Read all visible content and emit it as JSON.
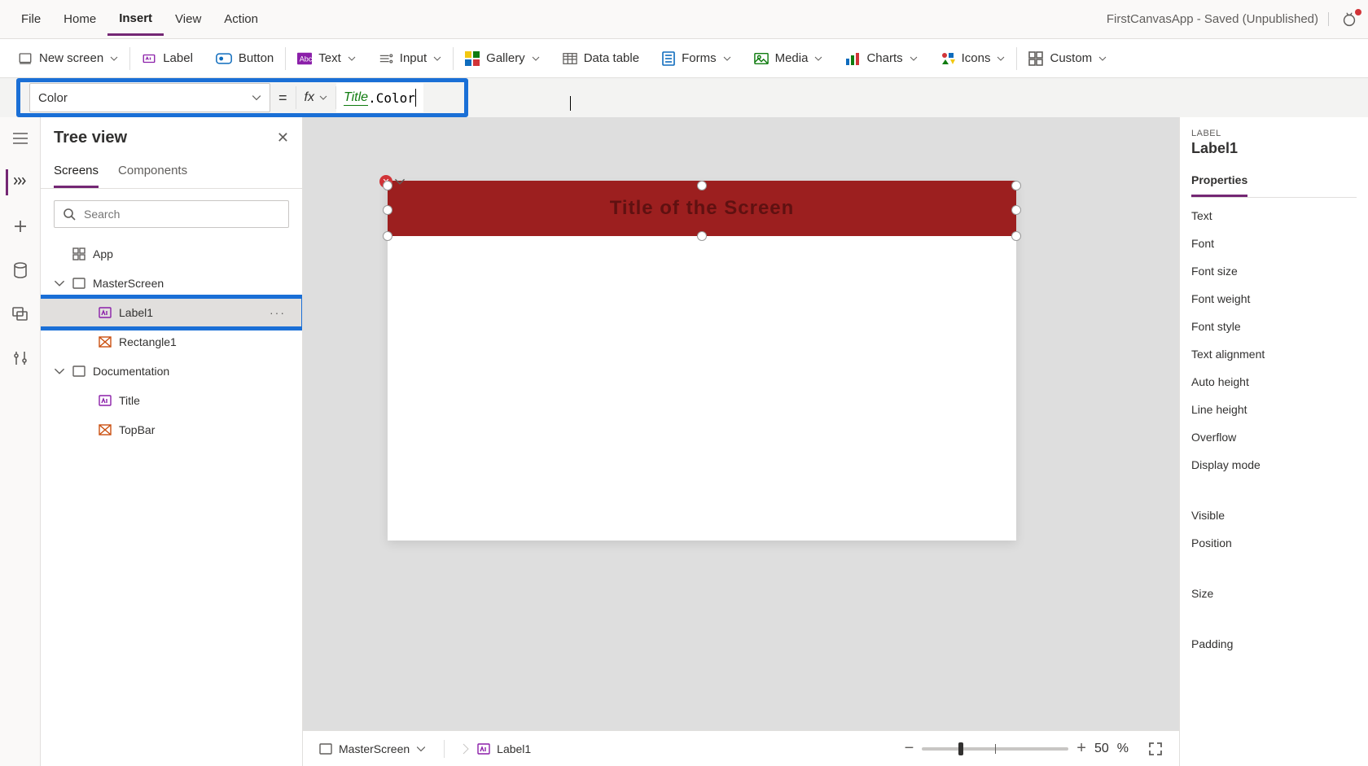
{
  "app": {
    "title": "FirstCanvasApp - Saved (Unpublished)"
  },
  "menu": {
    "file": "File",
    "home": "Home",
    "insert": "Insert",
    "view": "View",
    "action": "Action"
  },
  "ribbon": {
    "new_screen": "New screen",
    "label": "Label",
    "button": "Button",
    "text": "Text",
    "input": "Input",
    "gallery": "Gallery",
    "data_table": "Data table",
    "forms": "Forms",
    "media": "Media",
    "charts": "Charts",
    "icons": "Icons",
    "custom": "Custom"
  },
  "formula": {
    "property": "Color",
    "equals": "=",
    "fx": "fx",
    "ref": "Title",
    "dotprop": ".Color"
  },
  "tree": {
    "title": "Tree view",
    "tab_screens": "Screens",
    "tab_components": "Components",
    "search_placeholder": "Search",
    "items": {
      "app": "App",
      "master": "MasterScreen",
      "label1": "Label1",
      "rect1": "Rectangle1",
      "doc": "Documentation",
      "title_lbl": "Title",
      "topbar": "TopBar"
    }
  },
  "canvas": {
    "title_text": "Title of the Screen"
  },
  "breadcrumb": {
    "screen": "MasterScreen",
    "control": "Label1"
  },
  "zoom": {
    "value": "50",
    "pct": "%"
  },
  "rp": {
    "type": "LABEL",
    "name": "Label1",
    "tab_props": "Properties",
    "rows": {
      "text": "Text",
      "font": "Font",
      "font_size": "Font size",
      "font_weight": "Font weight",
      "font_style": "Font style",
      "text_align": "Text alignment",
      "auto_height": "Auto height",
      "line_height": "Line height",
      "overflow": "Overflow",
      "display_mode": "Display mode",
      "visible": "Visible",
      "position": "Position",
      "size": "Size",
      "padding": "Padding"
    }
  }
}
